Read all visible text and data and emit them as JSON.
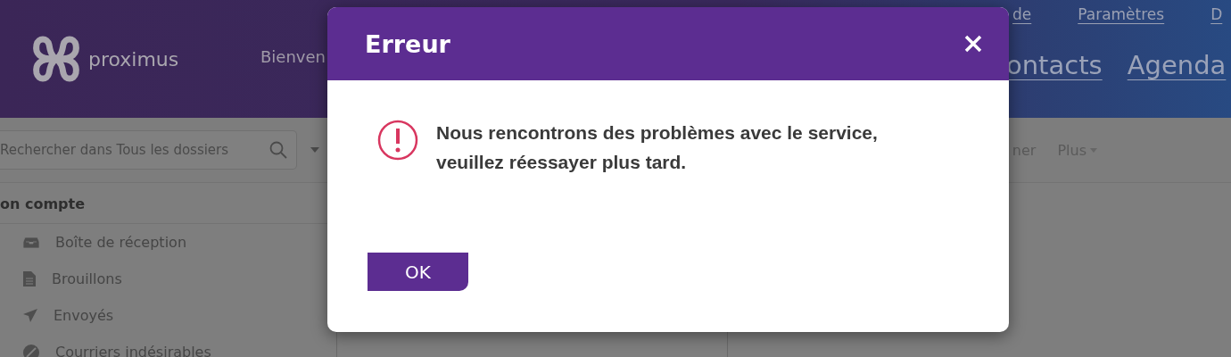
{
  "header": {
    "brand": "proximus",
    "greeting": "Bienven",
    "top_links": [
      "de",
      "Paramètres",
      "D"
    ],
    "nav_links": [
      "ontacts",
      "Agenda"
    ]
  },
  "toolbar": {
    "search": {
      "placeholder": "Rechercher dans Tous les dossiers"
    },
    "actions": [
      "ner",
      "Plus"
    ]
  },
  "sidebar": {
    "section": "on compte",
    "items": [
      {
        "label": "Boîte de réception"
      },
      {
        "label": "Brouillons"
      },
      {
        "label": "Envoyés"
      },
      {
        "label": "Courriers indésirables"
      }
    ]
  },
  "dialog": {
    "title": "Erreur",
    "message": "Nous rencontrons des problèmes avec le service, veuillez réessayer plus tard.",
    "button": "OK"
  }
}
